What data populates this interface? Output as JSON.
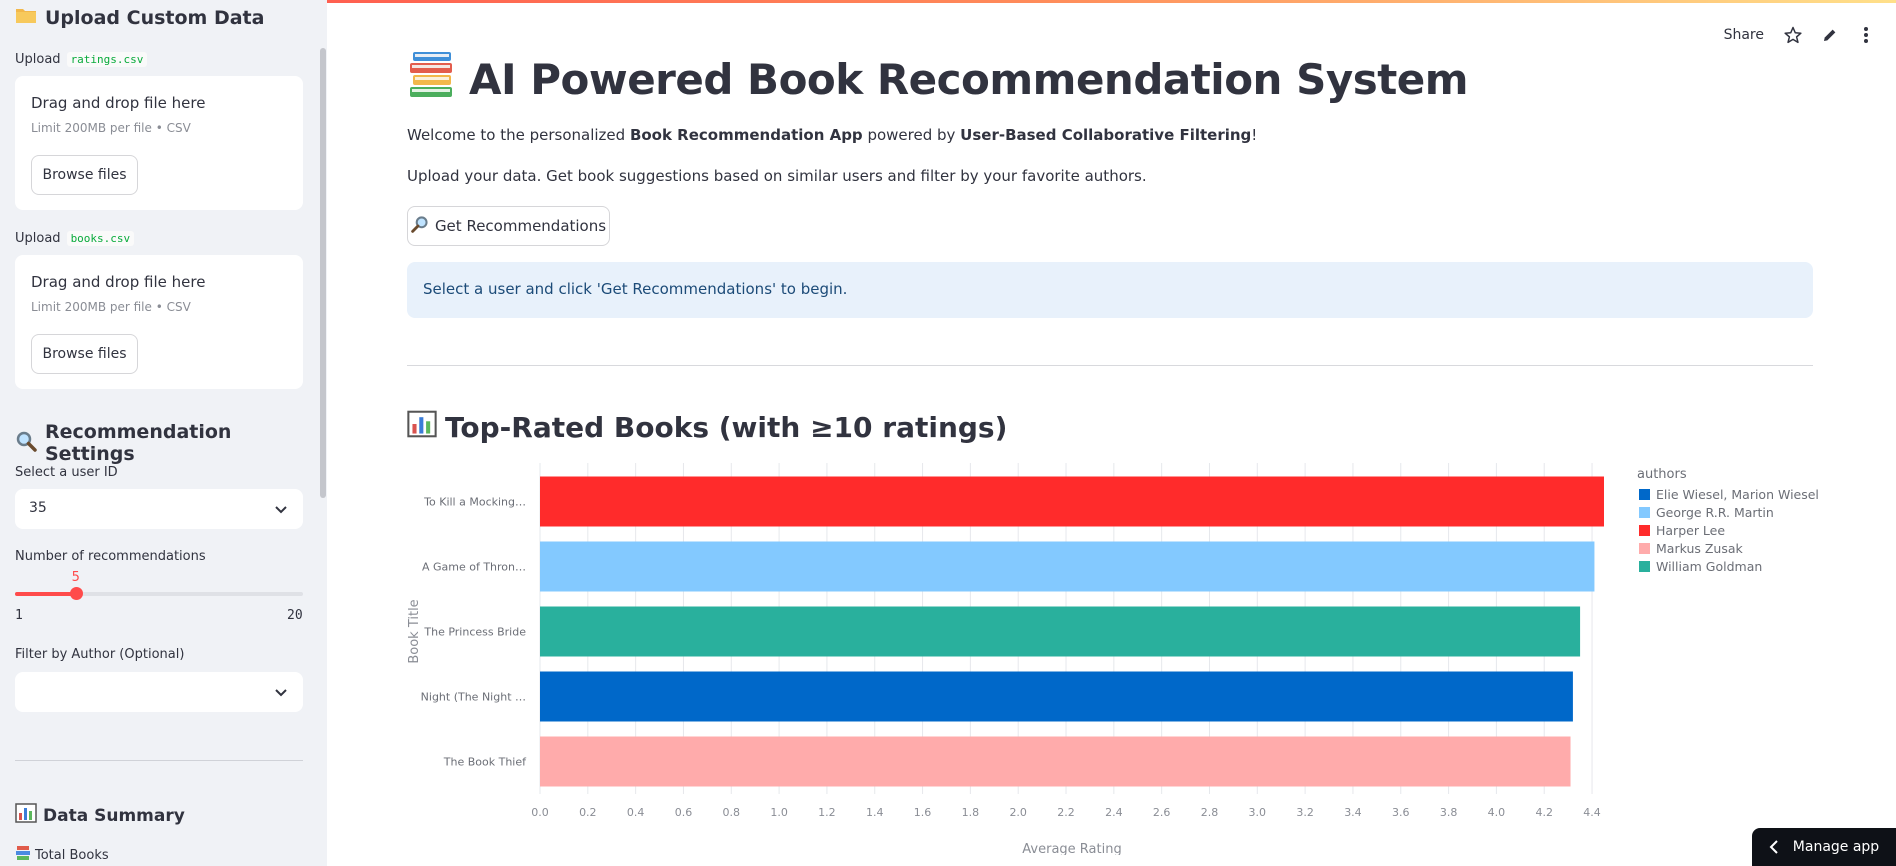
{
  "sidebar": {
    "upload_heading": "Upload Custom Data",
    "ratings_label_prefix": "Upload",
    "ratings_file": "ratings.csv",
    "books_label_prefix": "Upload",
    "books_file": "books.csv",
    "dropzone_title": "Drag and drop file here",
    "dropzone_limit": "Limit 200MB per file • CSV",
    "browse_label": "Browse files",
    "settings_heading": "Recommendation Settings",
    "user_select_label": "Select a user ID",
    "user_select_value": "35",
    "num_recs_label": "Number of recommendations",
    "num_recs_value": "5",
    "num_recs_fraction": 0.2105,
    "num_recs_min": "1",
    "num_recs_max": "20",
    "author_filter_label": "Filter by Author (Optional)",
    "author_filter_value": "",
    "summary_heading": "Data Summary",
    "total_books_label": "Total Books"
  },
  "header": {
    "share_label": "Share"
  },
  "main": {
    "title": "AI Powered Book Recommendation System",
    "intro_pre": "Welcome to the personalized ",
    "intro_bold1": "Book Recommendation App",
    "intro_mid": " powered by ",
    "intro_bold2": "User-Based Collaborative Filtering",
    "intro_post": "!",
    "subtitle": "Upload your data. Get book suggestions based on similar users and filter by your favorite authors.",
    "rec_button": "Get Recommendations",
    "info_text": "Select a user and click 'Get Recommendations' to begin.",
    "chart_heading": "Top-Rated Books (with ≥10 ratings)"
  },
  "manage_app_label": "Manage app",
  "colors": {
    "accent": "#ff4b4b",
    "harper_lee": "#ff2b2b",
    "george_martin": "#83c9ff",
    "william_goldman": "#29b09d",
    "elie_wiesel": "#0068c9",
    "markus_zusak": "#ffabab"
  },
  "chart_data": {
    "type": "bar",
    "orientation": "horizontal",
    "categories": [
      "To Kill a Mocking…",
      "A Game of Thron…",
      "The Princess Bride",
      "Night (The Night …",
      "The Book Thief"
    ],
    "values": [
      4.45,
      4.41,
      4.35,
      4.32,
      4.31
    ],
    "authors": [
      "Harper Lee",
      "George R.R. Martin",
      "William Goldman",
      "Elie Wiesel, Marion Wiesel",
      "Markus Zusak"
    ],
    "series_colors": [
      "#ff2b2b",
      "#83c9ff",
      "#29b09d",
      "#0068c9",
      "#ffabab"
    ],
    "xlabel": "Average Rating",
    "ylabel": "Book Title",
    "xticks": [
      "0.0",
      "0.2",
      "0.4",
      "0.6",
      "0.8",
      "1.0",
      "1.2",
      "1.4",
      "1.6",
      "1.8",
      "2.0",
      "2.2",
      "2.4",
      "2.6",
      "2.8",
      "3.0",
      "3.2",
      "3.4",
      "3.6",
      "3.8",
      "4.0",
      "4.2",
      "4.4"
    ],
    "xlim": [
      0,
      4.45
    ],
    "legend_title": "authors",
    "legend": [
      {
        "name": "Elie Wiesel, Marion Wiesel",
        "color": "#0068c9"
      },
      {
        "name": "George R.R. Martin",
        "color": "#83c9ff"
      },
      {
        "name": "Harper Lee",
        "color": "#ff2b2b"
      },
      {
        "name": "Markus Zusak",
        "color": "#ffabab"
      },
      {
        "name": "William Goldman",
        "color": "#29b09d"
      }
    ],
    "legend_position": "right",
    "grid": true
  }
}
